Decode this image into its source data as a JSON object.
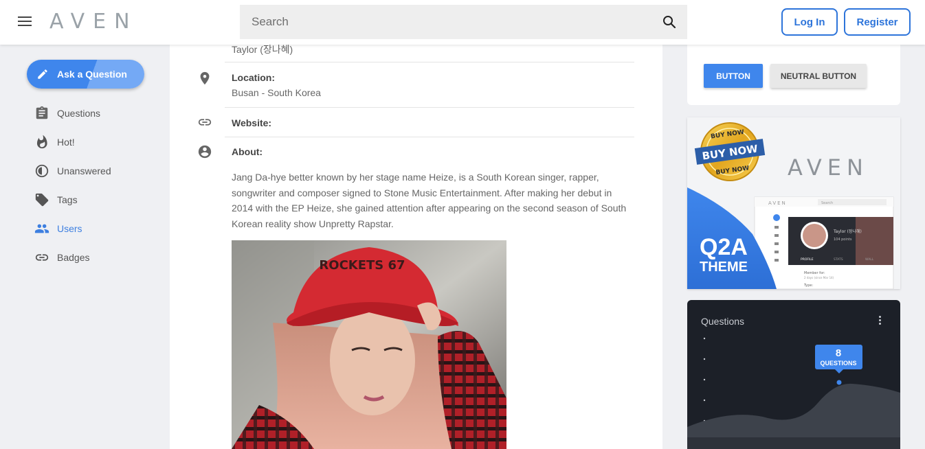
{
  "header": {
    "logo": "AVEN",
    "search_placeholder": "Search",
    "login_label": "Log In",
    "register_label": "Register"
  },
  "sidebar": {
    "ask_label": "Ask a Question",
    "items": [
      {
        "label": "Questions",
        "icon": "clipboard-icon"
      },
      {
        "label": "Hot!",
        "icon": "fire-icon"
      },
      {
        "label": "Unanswered",
        "icon": "half-circle-icon"
      },
      {
        "label": "Tags",
        "icon": "tag-icon"
      },
      {
        "label": "Users",
        "icon": "users-icon",
        "active": true
      },
      {
        "label": "Badges",
        "icon": "link-icon"
      }
    ],
    "active_color": "#3d7fe0"
  },
  "profile": {
    "name_partial": "Taylor (장나혜)",
    "location_label": "Location:",
    "location_value": "Busan - South Korea",
    "website_label": "Website:",
    "about_label": "About:",
    "about_text": "Jang Da-hye better known by her stage name Heize, is a South Korean singer, rapper, songwriter and composer signed to Stone Music Entertainment. After making her debut in 2014 with the EP Heize, she gained attention after appearing on the second season of South Korean reality show Unpretty Rapstar.",
    "photo_cap_text": "ROCKETS 67"
  },
  "right": {
    "button_label": "BUTTON",
    "neutral_button_label": "NEUTRAL BUTTON",
    "ad": {
      "badge_lines": [
        "BUY NOW",
        "BUY NOW",
        "BUY NOW"
      ],
      "logo": "AVEN",
      "title_line1": "Q2A",
      "title_line2": "THEME",
      "mini_logo": "AVEN",
      "mini_search": "Search",
      "mini_user": "Taylor (장나혜)",
      "mini_points": "104 points",
      "mini_tabs": [
        "PROFILE",
        "STATS",
        "WALL"
      ],
      "mini_member_for": "Member for:",
      "mini_member_value": "2 days (since Mar 14)",
      "mini_type": "Type:"
    },
    "stats": {
      "title": "Questions",
      "tooltip_value": "8",
      "tooltip_label": "QUESTIONS",
      "accent": "#3f86ec"
    }
  }
}
